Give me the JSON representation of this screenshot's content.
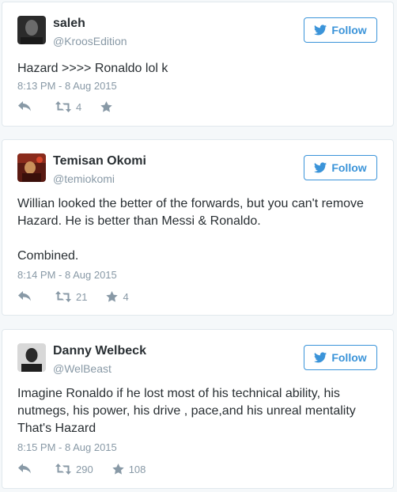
{
  "follow_label": "Follow",
  "colors": {
    "accent": "#3b94d9",
    "muted": "#8899a6",
    "text": "#292f33",
    "border": "#e1e8ed"
  },
  "tweets": [
    {
      "name": "saleh",
      "handle": "@KroosEdition",
      "text": [
        "Hazard >>>> Ronaldo lol k"
      ],
      "timestamp": "8:13 PM - 8 Aug 2015",
      "retweets": "4",
      "likes": ""
    },
    {
      "name": "Temisan Okomi",
      "handle": "@temiokomi",
      "text": [
        "Willian looked the better of the forwards, but you can't remove Hazard. He is better than Messi & Ronaldo.",
        "Combined."
      ],
      "timestamp": "8:14 PM - 8 Aug 2015",
      "retweets": "21",
      "likes": "4"
    },
    {
      "name": "Danny Welbeck",
      "handle": "@WelBeast",
      "text": [
        "Imagine Ronaldo if he lost most of his technical ability, his nutmegs, his power, his drive , pace,and his unreal mentality That's Hazard"
      ],
      "timestamp": "8:15 PM - 8 Aug 2015",
      "retweets": "290",
      "likes": "108"
    }
  ]
}
